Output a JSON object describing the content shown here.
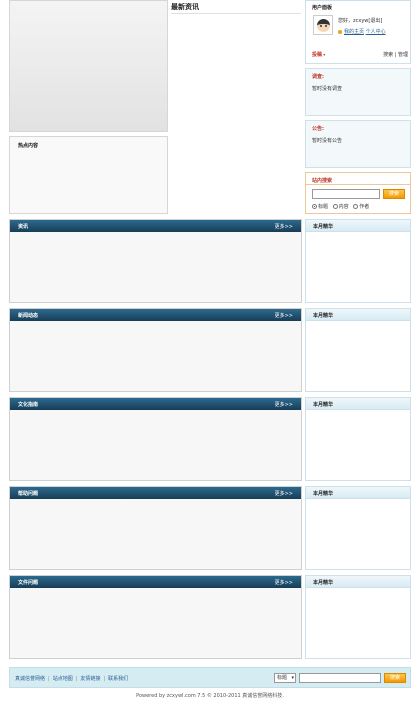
{
  "top": {
    "hot_title": "热点内容",
    "news_title": "最新资讯"
  },
  "user_panel": {
    "title": "用户面板",
    "greeting": "您好，zcxyw[退出]",
    "link_home": "我的主页",
    "link_center": "个人中心",
    "posts_label": "投稿",
    "posts_actions": "搜索 | 管理"
  },
  "survey": {
    "title": "调查:",
    "text": "暂时没有调查"
  },
  "notice": {
    "title": "公告:",
    "text": "暂时没有公告"
  },
  "site_search": {
    "title": "站内搜索",
    "button": "搜索",
    "options": [
      "标题",
      "内容",
      "作者"
    ],
    "selected": "标题"
  },
  "sections": [
    {
      "title": "资讯",
      "more": "更多>>",
      "side_title": "本月精华"
    },
    {
      "title": "新闻动态",
      "more": "更多>>",
      "side_title": "本月精华"
    },
    {
      "title": "文化指南",
      "more": "更多>>",
      "side_title": "本月精华"
    },
    {
      "title": "帮助问题",
      "more": "更多>>",
      "side_title": "本月精华"
    },
    {
      "title": "文件问题",
      "more": "更多>>",
      "side_title": "本月精华"
    }
  ],
  "footer": {
    "links": [
      "真诚信誉网络",
      "站点地图",
      "友情链接",
      "联系我们"
    ],
    "select_value": "标题",
    "button": "搜索",
    "powered": "Powered by zcxywl.com 7.5 © 2010-2011 真诚信誉网络科技."
  }
}
